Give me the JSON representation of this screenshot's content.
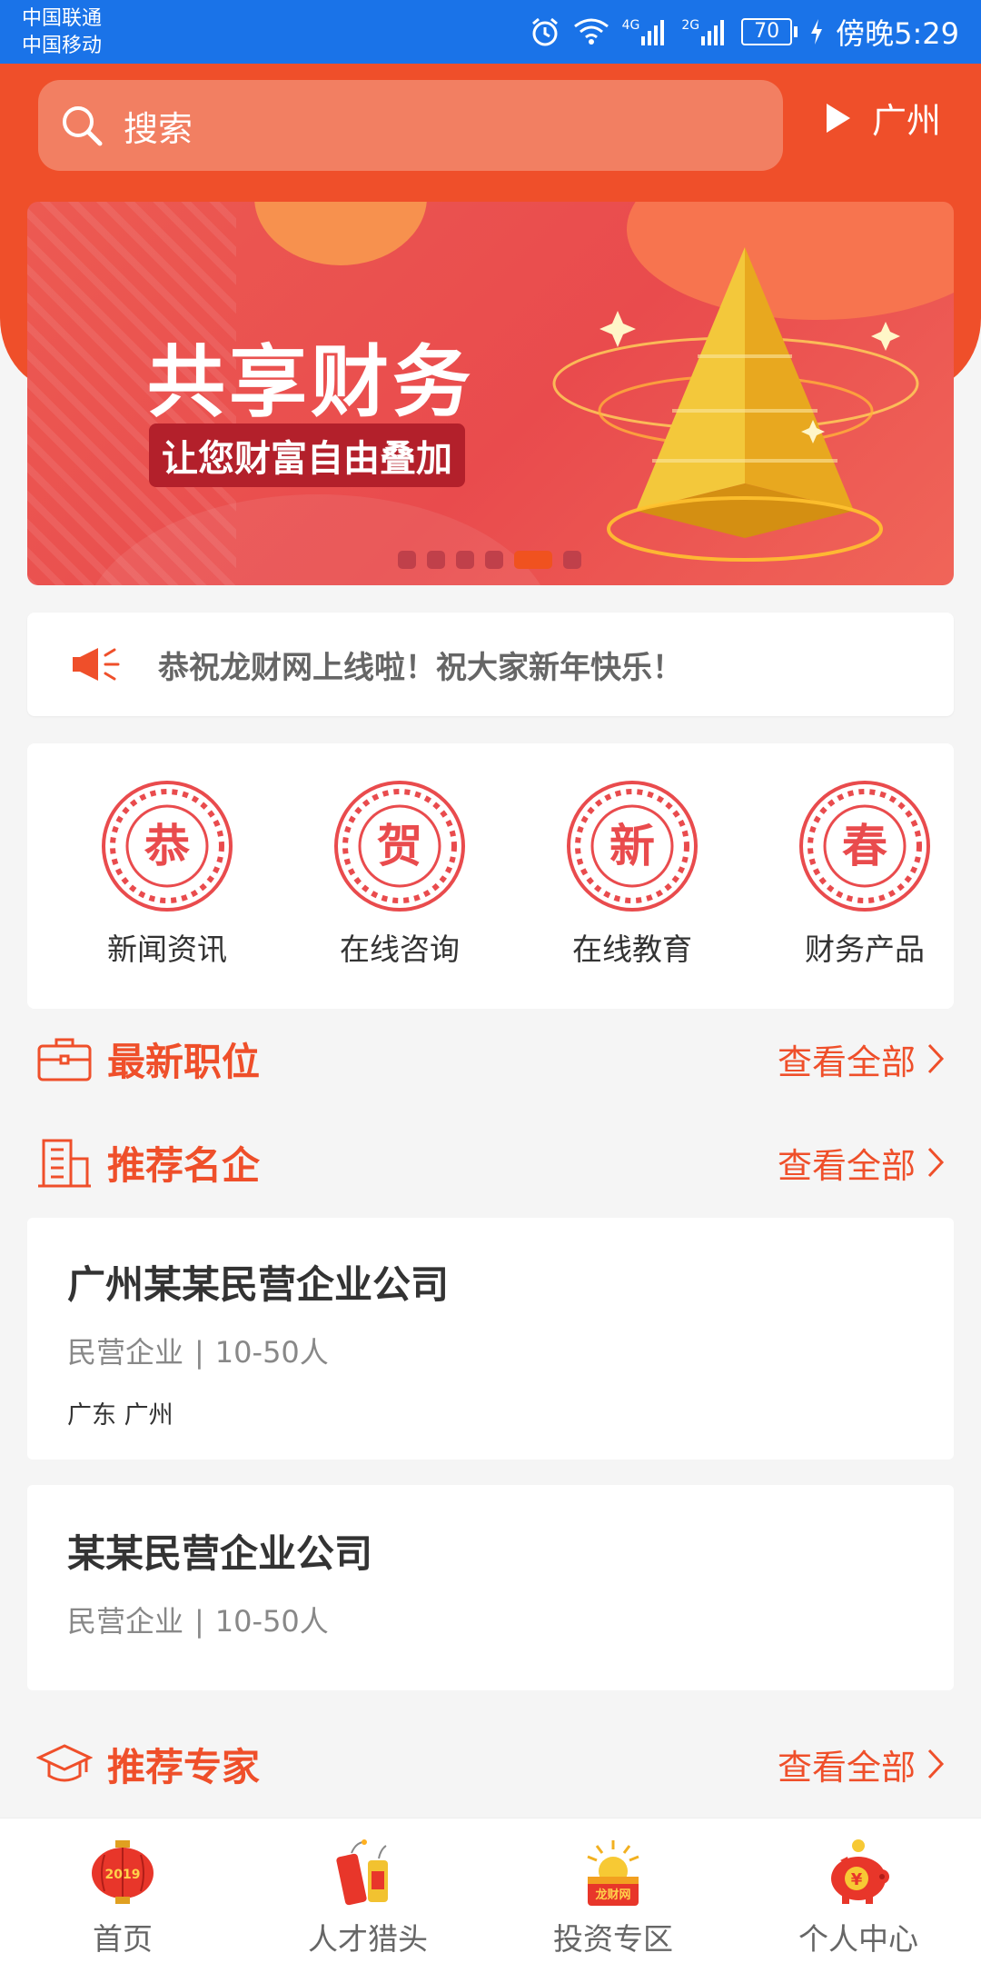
{
  "status_bar": {
    "carrier1": "中国联通",
    "carrier2": "中国移动",
    "net1": "4G",
    "net2": "2G",
    "battery": "70",
    "time": "傍晚5:29"
  },
  "header": {
    "search_placeholder": "搜索",
    "location": "广州",
    "accent_color": "#ef4f2a"
  },
  "banner": {
    "title": "共享财务",
    "subtitle": "让您财富自由叠加",
    "slide_count": 6,
    "active_slide": 5
  },
  "notice": {
    "text": "恭祝龙财网上线啦！祝大家新年快乐！",
    "icon": "megaphone-icon"
  },
  "categories": [
    {
      "char": "恭",
      "label": "新闻资讯"
    },
    {
      "char": "贺",
      "label": "在线咨询"
    },
    {
      "char": "新",
      "label": "在线教育"
    },
    {
      "char": "春",
      "label": "财务产品"
    }
  ],
  "sections": {
    "jobs": {
      "title": "最新职位",
      "more": "查看全部",
      "icon": "briefcase-icon"
    },
    "companies": {
      "title": "推荐名企",
      "more": "查看全部",
      "icon": "building-icon"
    },
    "experts": {
      "title": "推荐专家",
      "more": "查看全部",
      "icon": "graduation-cap-icon"
    }
  },
  "companies": [
    {
      "name": "广州某某民营企业公司",
      "type": "民营企业",
      "size": "10-50人",
      "location": "广东 广州"
    },
    {
      "name": "某某民营企业公司",
      "type": "民营企业",
      "size": "10-50人"
    }
  ],
  "meta_separator": "|",
  "bottom_nav": [
    {
      "label": "首页",
      "icon": "lantern-icon",
      "icon_text": "2019"
    },
    {
      "label": "人才猎头",
      "icon": "firecracker-icon"
    },
    {
      "label": "投资专区",
      "icon": "treasure-icon",
      "icon_text": "龙财网"
    },
    {
      "label": "个人中心",
      "icon": "piggy-bank-icon",
      "icon_text": "¥"
    }
  ]
}
